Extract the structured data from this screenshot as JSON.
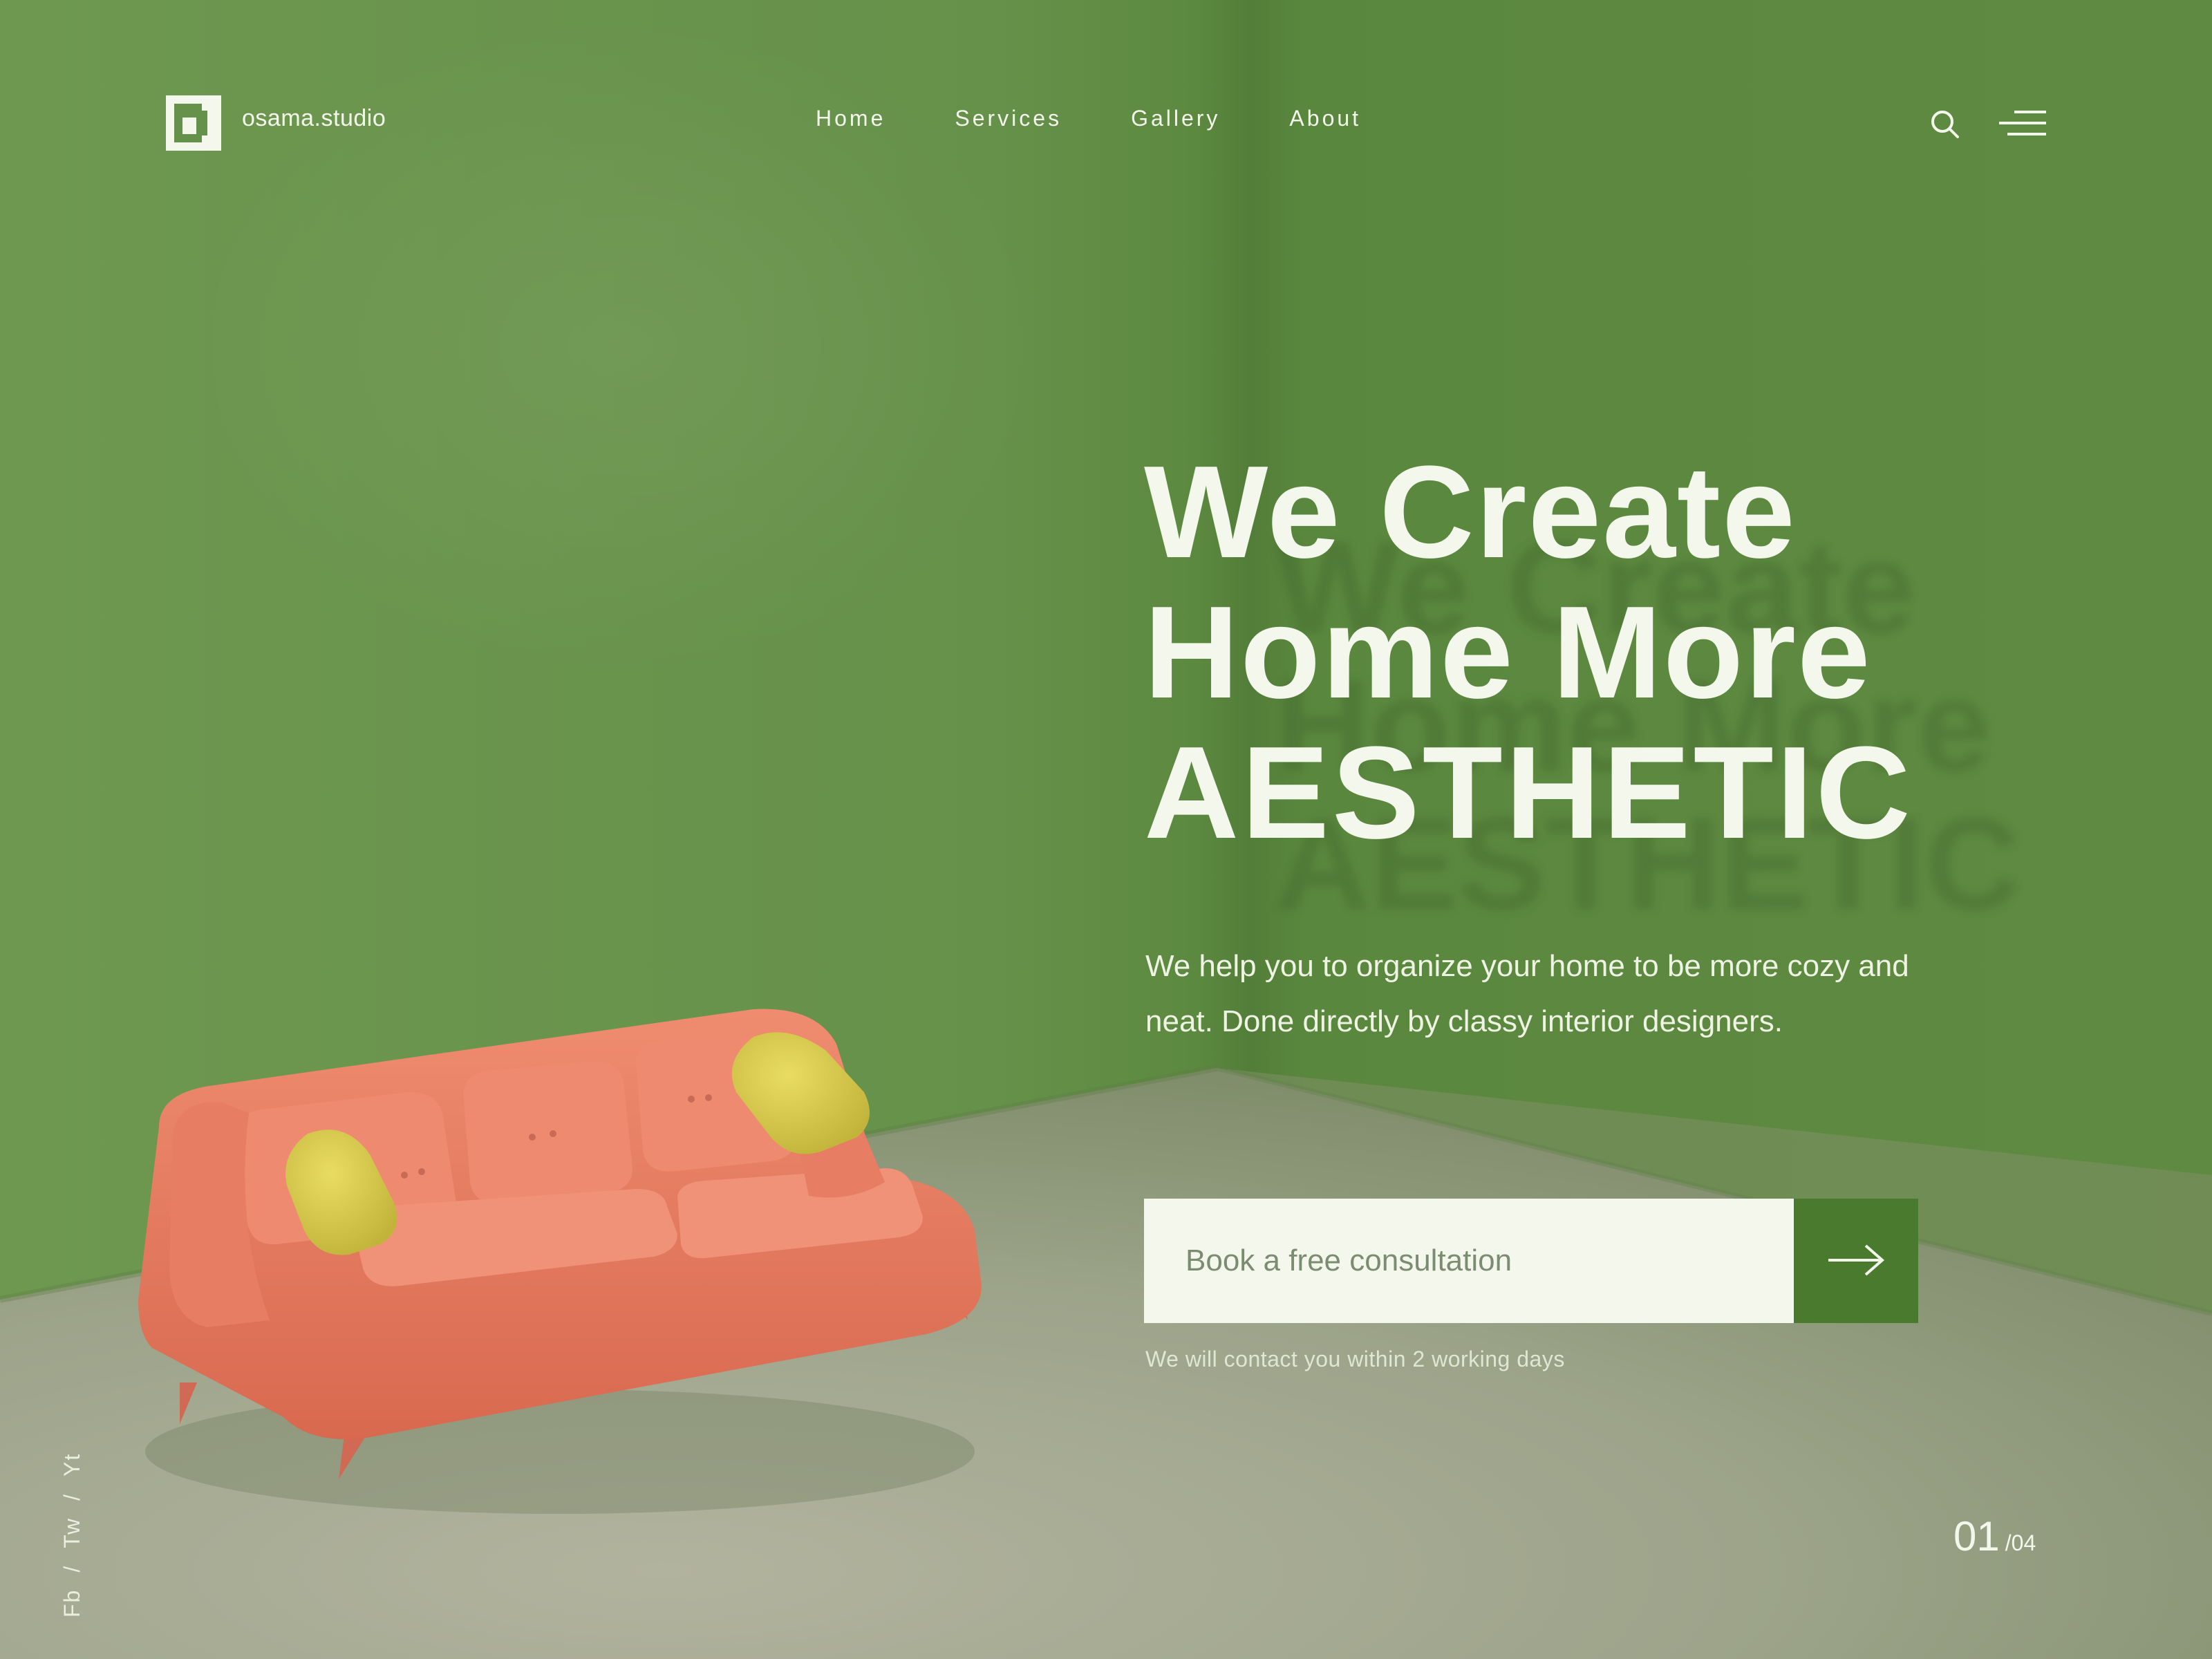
{
  "brand": {
    "name": "osama.studio"
  },
  "nav": {
    "items": [
      "Home",
      "Services",
      "Gallery",
      "About"
    ]
  },
  "header": {
    "search_icon": "search-icon",
    "menu_icon": "hamburger-menu-icon"
  },
  "hero": {
    "headline": [
      "We Create",
      "Home More",
      "AESTHETIC"
    ],
    "lead": "We help you to organize your home to be more cozy and neat. Done directly by classy interior designers.",
    "booking": {
      "placeholder": "Book a free consultation",
      "submit_icon": "arrow-right-icon",
      "note": "We will contact you within 2 working days"
    }
  },
  "social": {
    "items": [
      "Fb",
      "Tw",
      "Yt"
    ],
    "separator": "/"
  },
  "pager": {
    "current": "01",
    "total": "/04"
  },
  "colors": {
    "wall": "#66914a",
    "accent": "#4a7a2e",
    "text_light": "#f4f8ec",
    "sofa": "#e8856a",
    "pillow": "#d8c94a",
    "floor": "#a7aa92"
  }
}
